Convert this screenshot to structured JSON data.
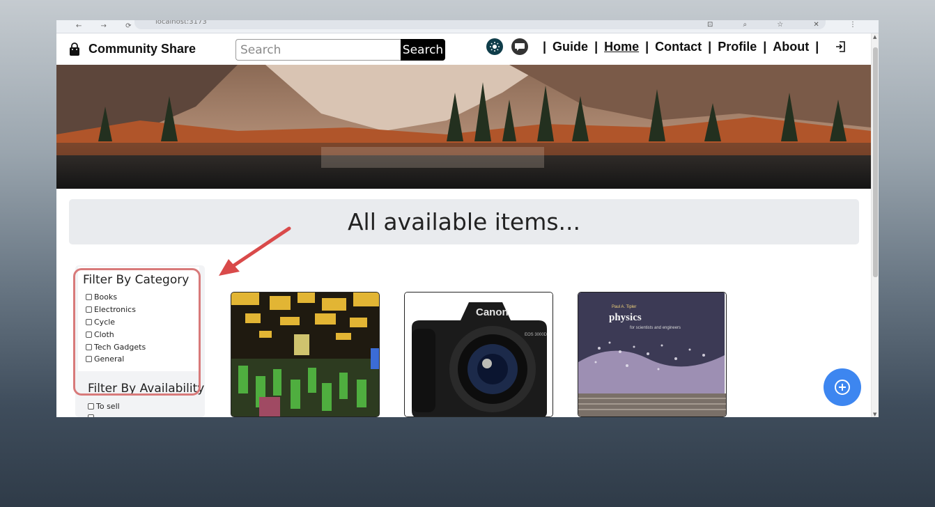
{
  "browser": {
    "nav_glyphs": "← → ⟳",
    "url": "localhost:3173",
    "toolbar_glyphs": "⊡ ⌕ ☆ ✕ ⋮"
  },
  "navbar": {
    "brand": "Community Share",
    "search_placeholder": "Search",
    "search_button": "Search",
    "links": {
      "guide": "Guide",
      "home": "Home",
      "contact": "Contact",
      "profile": "Profile",
      "about": "About"
    },
    "separator": "|"
  },
  "main": {
    "heading": "All available items..."
  },
  "sidebar": {
    "category_title": "Filter By Category",
    "categories": [
      "Books",
      "Electronics",
      "Cycle",
      "Cloth",
      "Tech Gadgets",
      "General"
    ],
    "availability_title": "Filter By Availability",
    "availability": [
      "To sell"
    ]
  },
  "cards": {
    "camera_brand": "Canon",
    "camera_model": "EOS 3000D",
    "book_author": "Paul A. Tipler",
    "book_title": "physics",
    "book_subtitle": "for scientists and engineers"
  },
  "colors": {
    "accent_blue": "#3d86f0",
    "annotation_red": "#d94a4a",
    "navbar_icon_dark": "#0f3d4a"
  },
  "icons": {
    "brand": "shopping-bag-icon",
    "theme": "sun-icon",
    "chat": "chat-bubble-icon",
    "logout": "logout-icon",
    "fab": "plus-circle-icon"
  }
}
